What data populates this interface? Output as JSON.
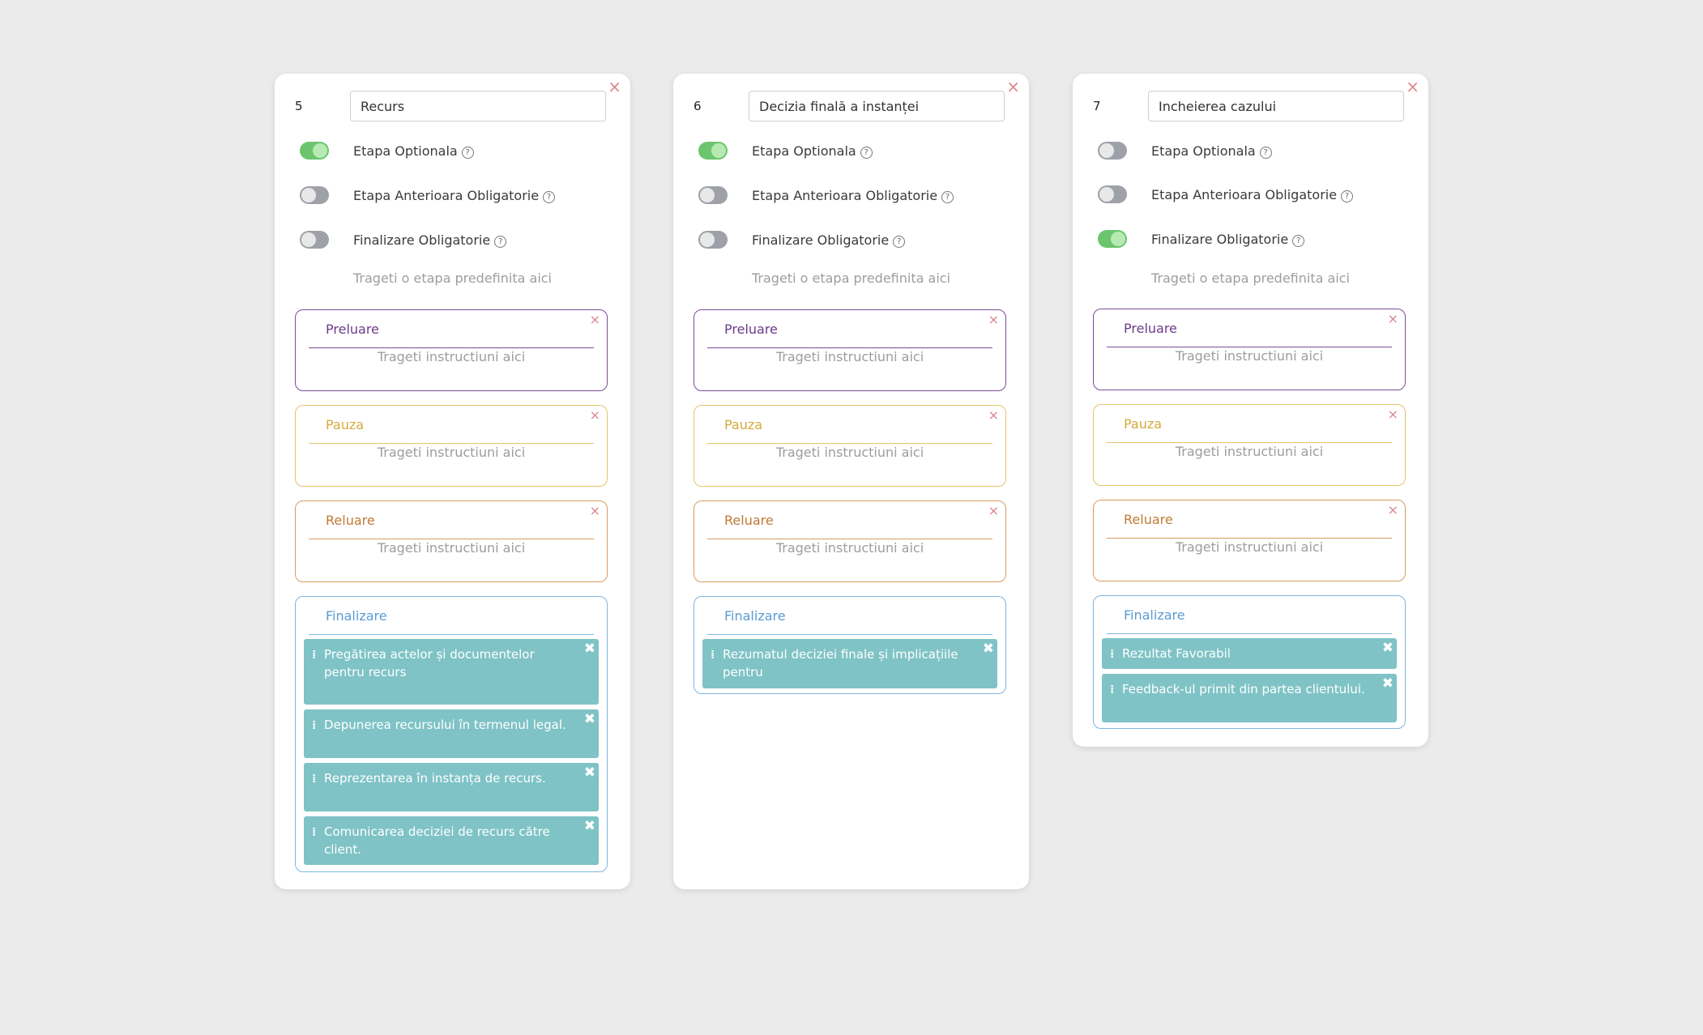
{
  "colors": {
    "background": "#ebebeb",
    "toggle_on": "#6cc56e",
    "toggle_off": "#9fa1a8",
    "preluare": "#7c4d9a",
    "pauza": "#e6c36c",
    "reluare": "#d99b5e",
    "finalizare": "#7fb5e0",
    "instruction_item": "#7fc3c6",
    "close": "#d9868b"
  },
  "icons": {
    "close": "×",
    "item_close": "✖",
    "help": "?",
    "grip": "⁞"
  },
  "steps": [
    {
      "number": "5",
      "name": "Recurs",
      "toggles": [
        {
          "label": "Etapa Optionala",
          "on": true
        },
        {
          "label": "Etapa Anterioara Obligatorie",
          "on": false
        },
        {
          "label": "Finalizare Obligatorie",
          "on": false
        }
      ],
      "drop_hint": "Trageti o etapa predefinita aici",
      "sections": [
        {
          "title": "Preluare",
          "hint": "Trageti instructiuni aici"
        },
        {
          "title": "Pauza",
          "hint": "Trageti instructiuni aici"
        },
        {
          "title": "Reluare",
          "hint": "Trageti instructiuni aici"
        }
      ],
      "final": {
        "title": "Finalizare",
        "items": [
          "Pregătirea actelor și documentelor pentru recurs",
          "Depunerea recursului în termenul legal.",
          "Reprezentarea în instanța de recurs.",
          "Comunicarea deciziei de recurs către client."
        ]
      }
    },
    {
      "number": "6",
      "name": "Decizia finală a instanței",
      "toggles": [
        {
          "label": "Etapa Optionala",
          "on": true
        },
        {
          "label": "Etapa Anterioara Obligatorie",
          "on": false
        },
        {
          "label": "Finalizare Obligatorie",
          "on": false
        }
      ],
      "drop_hint": "Trageti o etapa predefinita aici",
      "sections": [
        {
          "title": "Preluare",
          "hint": "Trageti instructiuni aici"
        },
        {
          "title": "Pauza",
          "hint": "Trageti instructiuni aici"
        },
        {
          "title": "Reluare",
          "hint": "Trageti instructiuni aici"
        }
      ],
      "final": {
        "title": "Finalizare",
        "items": [
          "Rezumatul deciziei finale și implicațiile pentru"
        ]
      }
    },
    {
      "number": "7",
      "name": "Incheierea cazului",
      "toggles": [
        {
          "label": "Etapa Optionala",
          "on": false
        },
        {
          "label": "Etapa Anterioara Obligatorie",
          "on": false
        },
        {
          "label": "Finalizare Obligatorie",
          "on": true
        }
      ],
      "drop_hint": "Trageti o etapa predefinita aici",
      "sections": [
        {
          "title": "Preluare",
          "hint": "Trageti instructiuni aici"
        },
        {
          "title": "Pauza",
          "hint": "Trageti instructiuni aici"
        },
        {
          "title": "Reluare",
          "hint": "Trageti instructiuni aici"
        }
      ],
      "final": {
        "title": "Finalizare",
        "items": [
          "Rezultat Favorabil",
          "Feedback-ul primit din partea clientului."
        ]
      }
    }
  ]
}
